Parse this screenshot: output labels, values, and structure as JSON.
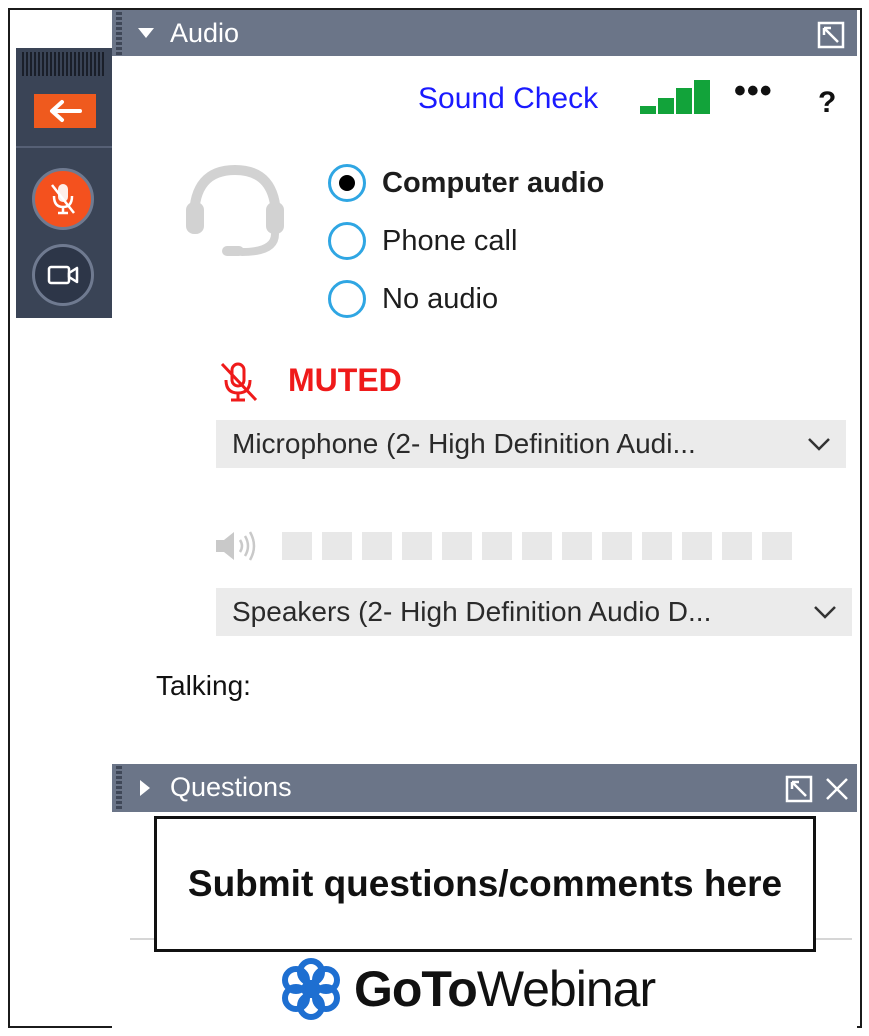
{
  "audio_panel": {
    "title": "Audio",
    "sound_check": "Sound Check",
    "more_label": "•••",
    "help_label": "?",
    "options": [
      {
        "label": "Computer audio",
        "selected": true
      },
      {
        "label": "Phone call",
        "selected": false
      },
      {
        "label": "No audio",
        "selected": false
      }
    ],
    "mute_status": "MUTED",
    "microphone_select": "Microphone (2- High Definition Audi...",
    "speaker_select": "Speakers (2- High Definition Audio D...",
    "talking_label": "Talking:"
  },
  "questions_panel": {
    "title": "Questions",
    "callout": "Submit questions/comments here"
  },
  "brand": {
    "name_bold": "GoTo",
    "name_regular": "Webinar"
  },
  "colors": {
    "header": "#6b7588",
    "control_strip": "#3a4456",
    "accent_orange": "#ef5a1e",
    "muted_red": "#ef1a1a",
    "link_blue": "#1a1aff",
    "signal_green": "#12a33a",
    "radio_blue": "#2fa6e3"
  }
}
